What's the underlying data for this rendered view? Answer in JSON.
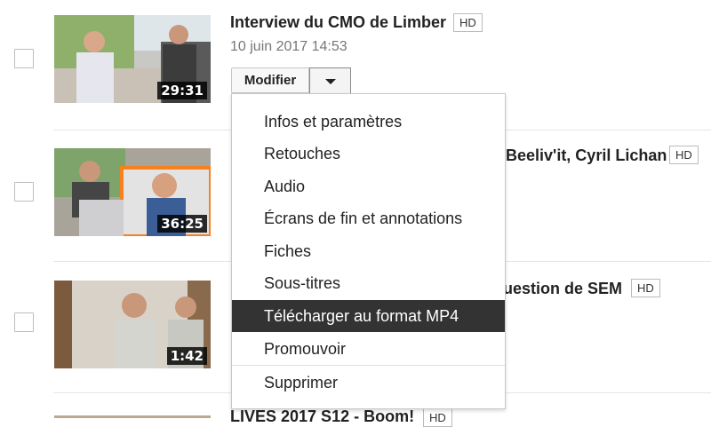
{
  "videos": [
    {
      "title": "Interview du CMO de Limber",
      "hd": "HD",
      "date": "10 juin 2017 14:53",
      "duration": "29:31",
      "edit_label": "Modifier"
    },
    {
      "title": "Beeliv'it, Cyril Lichan",
      "hd": "HD",
      "duration": "36:25"
    },
    {
      "title": "uestion de SEM",
      "hd": "HD",
      "duration": "1:42"
    },
    {
      "title": "LIVES 2017 S12 - Boom!",
      "hd": "HD"
    }
  ],
  "menu": {
    "items": [
      "Infos et paramètres",
      "Retouches",
      "Audio",
      "Écrans de fin et annotations",
      "Fiches",
      "Sous-titres",
      "Télécharger au format MP4",
      "Promouvoir",
      "Supprimer"
    ],
    "highlighted": "Télécharger au format MP4"
  },
  "colors": {
    "menu_highlight": "#333333",
    "hd_border": "#bbbbbb",
    "date_text": "#777777",
    "thumb_accent": "#f5821f"
  }
}
